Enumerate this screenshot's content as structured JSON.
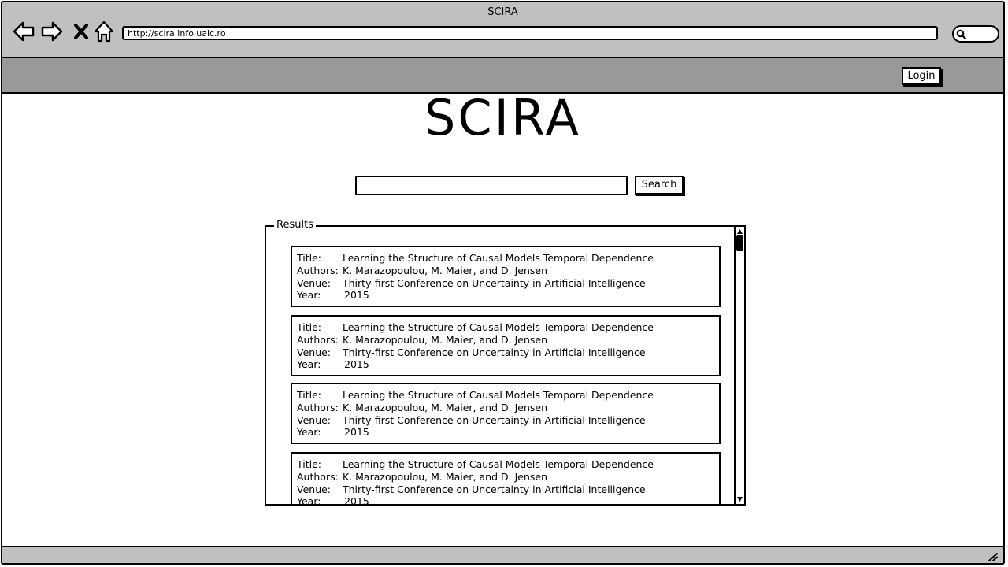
{
  "window": {
    "title": "SCIRA"
  },
  "browser": {
    "url": "http://scira.info.uaic.ro",
    "icons": [
      "back-arrow-icon",
      "forward-arrow-icon",
      "close-icon",
      "home-icon",
      "search-icon"
    ]
  },
  "toolbar": {
    "login_label": "Login"
  },
  "main": {
    "logo": "SCIRA",
    "search_button": "Search",
    "search_query": ""
  },
  "results": {
    "legend": "Results",
    "labels": {
      "title": "Title:",
      "authors": "Authors:",
      "venue": "Venue:",
      "year": "Year:"
    },
    "items": [
      {
        "title": "Learning the Structure of Causal Models Temporal Dependence",
        "authors": "K. Marazopoulou, M. Maier, and D. Jensen",
        "venue": "Thirty-first Conference on Uncertainty in Artificial Intelligence",
        "year": "2015"
      },
      {
        "title": "Learning the Structure of Causal Models Temporal Dependence",
        "authors": "K. Marazopoulou, M. Maier, and D. Jensen",
        "venue": "Thirty-first Conference on Uncertainty in Artificial Intelligence",
        "year": "2015"
      },
      {
        "title": "Learning the Structure of Causal Models Temporal Dependence",
        "authors": "K. Marazopoulou, M. Maier, and D. Jensen",
        "venue": "Thirty-first Conference on Uncertainty in Artificial Intelligence",
        "year": "2015"
      },
      {
        "title": "Learning the Structure of Causal Models Temporal Dependence",
        "authors": "K. Marazopoulou, M. Maier, and D. Jensen",
        "venue": "Thirty-first Conference on Uncertainty in Artificial Intelligence",
        "year": "2015"
      }
    ]
  }
}
